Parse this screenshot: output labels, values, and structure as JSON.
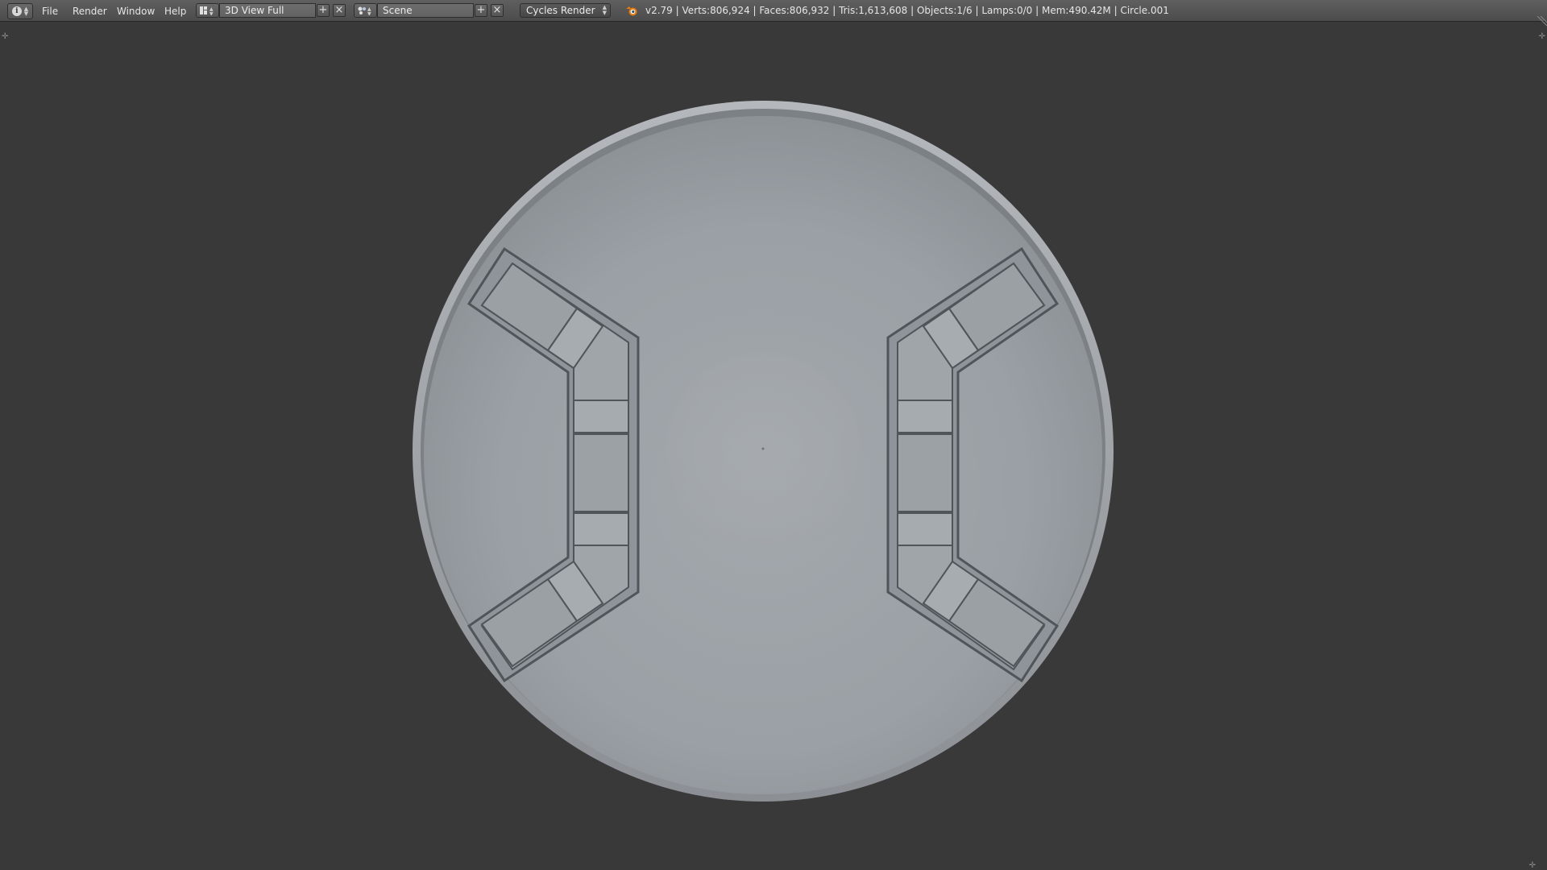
{
  "menu": {
    "items": [
      "File",
      "Render",
      "Window",
      "Help"
    ]
  },
  "screen_layout": {
    "value": "3D View Full"
  },
  "scene": {
    "value": "Scene"
  },
  "render_engine": {
    "value": "Cycles Render"
  },
  "stats": {
    "text": "v2.79 | Verts:806,924 | Faces:806,932 | Tris:1,613,608 | Objects:1/6 | Lamps:0/0 | Mem:490.42M | Circle.001"
  },
  "icons": {
    "info": "info-icon",
    "layout": "screen-layout-icon",
    "scene": "scene-icon",
    "add": "plus-icon",
    "remove": "x-icon",
    "logo": "blender-logo-icon"
  },
  "colors": {
    "header": "#4c4c4c",
    "viewport_bg": "#393939",
    "model": "#9aa0a5"
  }
}
